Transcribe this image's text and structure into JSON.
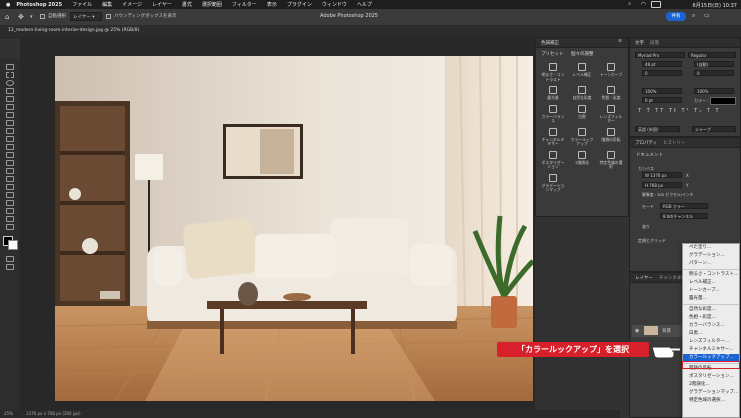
{
  "menubar": {
    "app": "Photoshop 2025",
    "items": [
      "ファイル",
      "編集",
      "イメージ",
      "レイヤー",
      "書式",
      "選択範囲",
      "フィルター",
      "表示",
      "プラグイン",
      "ウィンドウ",
      "ヘルプ"
    ],
    "clock": "6月15日(日) 10:37"
  },
  "optionbar": {
    "auto_select": "自動選択",
    "layer_dropdown": "レイヤー",
    "transform_controls": "バウンディングボックスを表示",
    "window_title": "Adobe Photoshop 2025",
    "share_button": "共有"
  },
  "document": {
    "tab_title": "12_modern-living-room-interior-design.jpg @ 25% (RGB/8)",
    "status_zoom": "25%",
    "status_info": "1376 px x 768 px (300 ppi)"
  },
  "adjustments": {
    "title": "色調補正",
    "tabs": [
      "プリセット",
      "個々の調整"
    ],
    "items": [
      "明るさ・コントラスト",
      "レベル補正",
      "トーンカーブ",
      "露光量",
      "自然な彩度",
      "色相・彩度",
      "カラーバランス",
      "白黒",
      "レンズフィルター",
      "チャンネルミキサー",
      "カラールックアップ",
      "階調の反転",
      "ポスタリゼーション",
      "2階調化",
      "特定色域の選択",
      "グラデーションマップ"
    ]
  },
  "character": {
    "tabs": [
      "文字",
      "段落"
    ],
    "font_family": "Myriad Pro",
    "font_style": "Regular",
    "size": "48 pt",
    "leading": "(自動)",
    "kerning": "0",
    "tracking": "0",
    "scale_v": "100%",
    "scale_h": "100%",
    "baseline": "0 pt",
    "color_label": "カラー :",
    "lang": "英語 (米国)",
    "aa": "シャープ"
  },
  "properties": {
    "tabs": [
      "プロパティ",
      "ヒストリー"
    ],
    "doc_label": "ドキュメント",
    "canvas_section": "カンバス",
    "width": "W  1376 px",
    "height": "H  768 px",
    "x": "X",
    "y": "Y",
    "resolution": "解像度 : 300 ピクセル/インチ",
    "mode_label": "モード",
    "mode_value": "RGB カラー",
    "bits_value": "8 bit/チャンネル",
    "fill_label": "塗り",
    "grid_section": "定規とグリッド"
  },
  "layers": {
    "tabs": [
      "レイヤー",
      "チャンネル",
      "パス"
    ],
    "bg_layer": "背景"
  },
  "context_menu": {
    "items": [
      "べた塗り...",
      "グラデーション...",
      "パターン...",
      "---",
      "明るさ・コントラスト...",
      "レベル補正...",
      "トーンカーブ...",
      "露光量...",
      "---",
      "自然な彩度...",
      "色相・彩度...",
      "カラーバランス...",
      "白黒...",
      "レンズフィルター...",
      "チャンネルミキサー...",
      "カラールックアップ...",
      "---",
      "階調の反転",
      "ポスタリゼーション...",
      "2階調化...",
      "グラデーションマップ...",
      "特定色域の選択..."
    ],
    "selected_index": 15
  },
  "callout": {
    "text": "「カラールックアップ」を選択"
  },
  "colors": {
    "accent": "#1a64d2",
    "callout_red": "#d8202a",
    "menubar": "#1e1e1e",
    "panel": "#3a3a3a"
  }
}
